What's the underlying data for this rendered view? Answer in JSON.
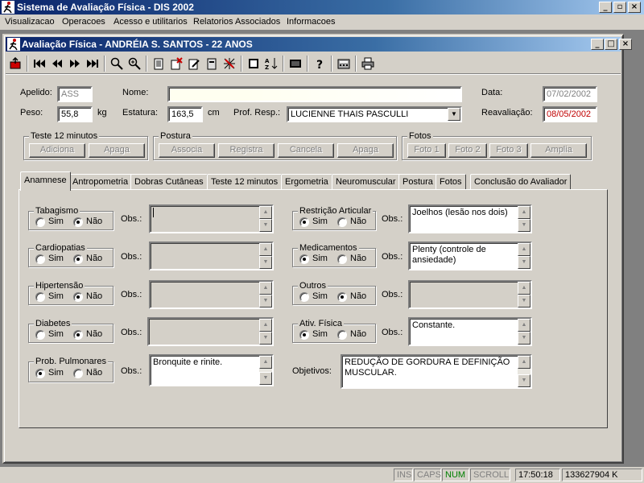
{
  "app": {
    "title": "Sistema de Avaliação Física - DIS 2002",
    "menu": [
      "Visualizacao",
      "Operacoes",
      "Acesso e utilitarios",
      "Relatorios Associados",
      "Informacoes"
    ]
  },
  "child": {
    "title": "Avaliação Física - ANDRÉIA S. SANTOS - 22 ANOS"
  },
  "header": {
    "apelido_label": "Apelido:",
    "apelido_value": "ASS",
    "nome_label": "Nome:",
    "nome_value": "",
    "data_label": "Data:",
    "data_value": "07/02/2002",
    "peso_label": "Peso:",
    "peso_value": "55,8",
    "peso_unit": "kg",
    "estatura_label": "Estatura:",
    "estatura_value": "163,5",
    "estatura_unit": "cm",
    "prof_label": "Prof. Resp.:",
    "prof_value": "LUCIENNE THAIS PASCULLI",
    "reaval_label": "Reavaliação:",
    "reaval_value": "08/05/2002"
  },
  "groups": {
    "teste": {
      "label": "Teste 12 minutos",
      "buttons": [
        "Adiciona",
        "Apaga"
      ]
    },
    "postura": {
      "label": "Postura",
      "buttons": [
        "Associa",
        "Registra",
        "Cancela",
        "Apaga"
      ]
    },
    "fotos": {
      "label": "Fotos",
      "buttons": [
        "Foto 1",
        "Foto 2",
        "Foto 3",
        "Amplia"
      ]
    }
  },
  "tabs": [
    "Anamnese",
    "Antropometria",
    "Dobras Cutâneas",
    "Teste 12 minutos",
    "Ergometria",
    "Neuromuscular",
    "Postura",
    "Fotos",
    "Conclusão do Avaliador"
  ],
  "anamnese": {
    "sim": "Sim",
    "nao": "Não",
    "obs": "Obs.:",
    "left": [
      {
        "label": "Tabagismo",
        "sim": false,
        "obs": ""
      },
      {
        "label": "Cardiopatias",
        "sim": false,
        "obs": ""
      },
      {
        "label": "Hipertensão",
        "sim": false,
        "obs": ""
      },
      {
        "label": "Diabetes",
        "sim": false,
        "obs": ""
      },
      {
        "label": "Prob. Pulmonares",
        "sim": true,
        "obs": "Bronquite e rinite."
      }
    ],
    "right": [
      {
        "label": "Restrição Articular",
        "sim": true,
        "obs": "Joelhos (lesão nos dois)"
      },
      {
        "label": "Medicamentos",
        "sim": true,
        "obs": "Plenty (controle de ansiedade)"
      },
      {
        "label": "Outros",
        "sim": false,
        "obs": ""
      },
      {
        "label": "Ativ. Física",
        "sim": true,
        "obs": "Constante."
      }
    ],
    "objetivos_label": "Objetivos:",
    "objetivos_value": "REDUÇÃO DE GORDURA E DEFINIÇÃO MUSCULAR."
  },
  "status": {
    "ins": "INS",
    "caps": "CAPS",
    "num": "NUM",
    "scroll": "SCROLL",
    "time": "17:50:18",
    "memory": "133627904 K"
  },
  "colors": {
    "titlebar": "#0a246a",
    "face": "#d4d0c8",
    "reaval_text": "#c00000",
    "num_indicator": "#008000"
  }
}
